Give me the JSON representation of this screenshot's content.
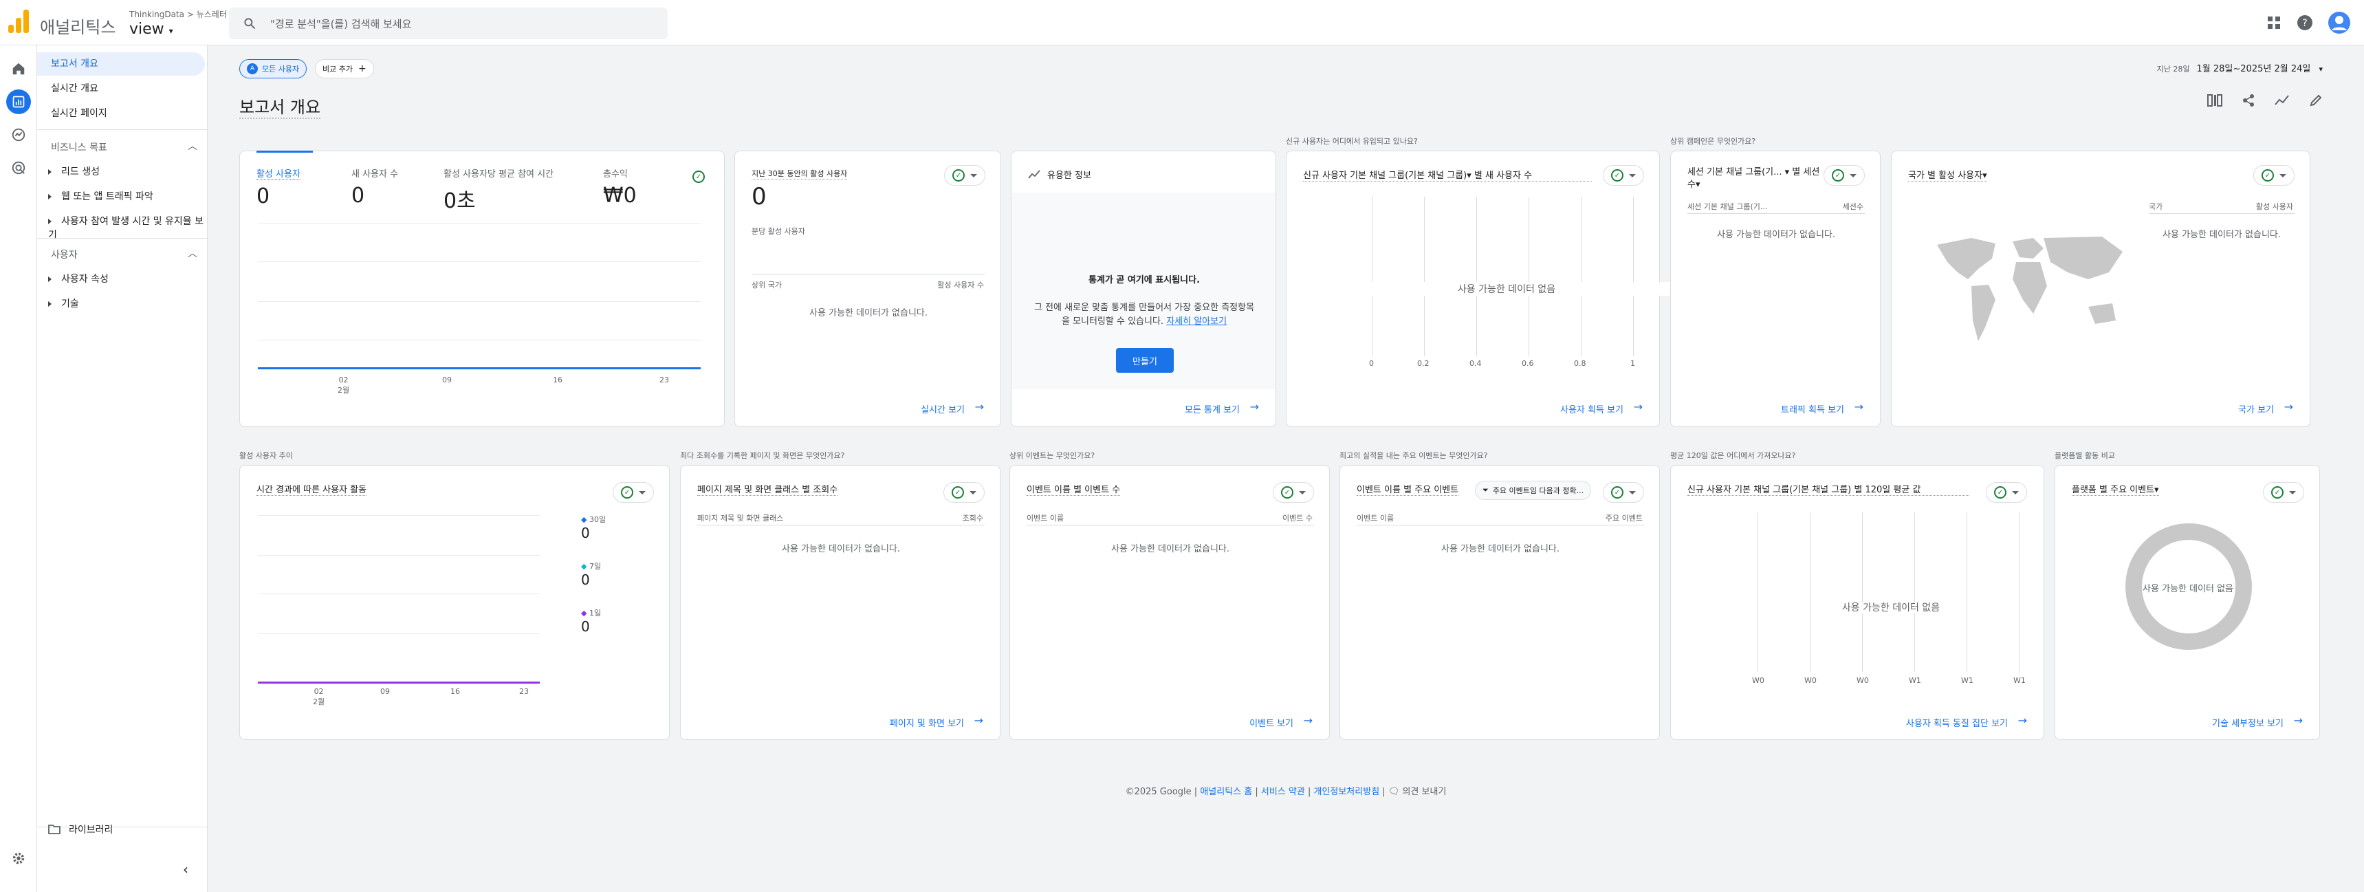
{
  "app": {
    "name": "애널리틱스",
    "account": "ThinkingData > 뉴스레터",
    "property": "view"
  },
  "search": {
    "placeholder": "\"경로 분석\"을(를) 검색해 보세요"
  },
  "nav": {
    "items": [
      "보고서 개요",
      "실시간 개요",
      "실시간 페이지"
    ],
    "sections": [
      {
        "title": "비즈니스 목표",
        "items": [
          "리드 생성",
          "웹 또는 앱 트래픽 파악",
          "사용자 참여 발생 시간 및 유지율 보기"
        ]
      },
      {
        "title": "사용자",
        "items": [
          "사용자 속성",
          "기술"
        ]
      }
    ],
    "library": "라이브러리"
  },
  "toolbar": {
    "chip_all": "모든 사용자",
    "chip_add": "비교 추가",
    "date_prefix": "지난 28일",
    "date_range": "1월 28일~2025년 2월 24일"
  },
  "page_title": "보고서 개요",
  "top_questions": {
    "q1": "신규 사용자는 어디에서 유입되고 있나요?",
    "q2": "상위 캠페인은 무엇인가요?"
  },
  "card1": {
    "metrics": [
      {
        "label": "활성 사용자",
        "value": "0"
      },
      {
        "label": "새 사용자 수",
        "value": "0"
      },
      {
        "label": "활성 사용자당 평균 참여 시간",
        "value": "0초"
      },
      {
        "label": "총수익",
        "value": "₩0"
      }
    ],
    "xticks": [
      "02\n2월",
      "09",
      "16",
      "23"
    ]
  },
  "card2": {
    "title": "지난 30분 동안의 활성 사용자",
    "value": "0",
    "sub": "분당 활성 사용자",
    "col1": "상위 국가",
    "col2": "활성 사용자 수",
    "empty": "사용 가능한 데이터가 없습니다.",
    "link": "실시간 보기"
  },
  "card3": {
    "title": "유용한 정보",
    "heading": "통계가 곧 여기에 표시됩니다.",
    "body": "그 전에 새로운 맞춤 통계를 만들어서 가장 중요한 측정항목을 모니터링할 수 있습니다.",
    "learn": "자세히 알아보기",
    "button": "만들기",
    "link": "모든 통계 보기"
  },
  "card4": {
    "title": "신규 사용자 기본 채널 그룹(기본 채널 그룹)▾ 별 새 사용자 수",
    "empty": "사용 가능한 데이터 없음",
    "xticks": [
      "0",
      "0.2",
      "0.4",
      "0.6",
      "0.8",
      "1"
    ],
    "link": "사용자 획득 보기"
  },
  "card5": {
    "title": "세션 기본 채널 그룹(기... ▾ 별 세션수▾",
    "col1": "세션 기본 채널 그룹(기...",
    "col2": "세션수",
    "empty": "사용 가능한 데이터가 없습니다.",
    "link": "트래픽 획득 보기"
  },
  "card6": {
    "title": "국가 별 활성 사용자▾",
    "col1": "국가",
    "col2": "활성 사용자",
    "empty": "사용 가능한 데이터가 없습니다.",
    "link": "국가 보기"
  },
  "row2_questions": {
    "a": "활성 사용자 추이",
    "b": "최다 조회수를 기록한 페이지 및 화면은 무엇인가요?",
    "c": "상위 이벤트는 무엇인가요?",
    "d": "최고의 실적을 내는 주요 이벤트는 무엇인가요?",
    "e": "평균 120일 값은 어디에서 가져오나요?",
    "f": "플랫폼별 활동 비교"
  },
  "card7": {
    "title": "시간 경과에 따른 사용자 활동",
    "legend": [
      {
        "label": "30일",
        "value": "0",
        "color": "#1a73e8"
      },
      {
        "label": "7일",
        "value": "0",
        "color": "#12b5cb"
      },
      {
        "label": "1일",
        "value": "0",
        "color": "#9334e6"
      }
    ],
    "xticks": [
      "02\n2월",
      "09",
      "16",
      "23"
    ]
  },
  "card8": {
    "title": "페이지 제목 및 화면 클래스 별 조회수",
    "col1": "페이지 제목 및 화면 클래스",
    "col2": "조회수",
    "empty": "사용 가능한 데이터가 없습니다.",
    "link": "페이지 및 화면 보기"
  },
  "card9": {
    "title": "이벤트 이름 별 이벤트 수",
    "col1": "이벤트 이름",
    "col2": "이벤트 수",
    "empty": "사용 가능한 데이터가 없습니다.",
    "link": "이벤트 보기"
  },
  "card10": {
    "title": "이벤트 이름 별 주요 이벤트",
    "filter": "주요 이벤트임 다음과 정확...",
    "col1": "이벤트 이름",
    "col2": "주요 이벤트",
    "empty": "사용 가능한 데이터가 없습니다."
  },
  "card11": {
    "title": "신규 사용자 기본 채널 그룹(기본 채널 그룹) 별 120일 평균 값",
    "empty": "사용 가능한 데이터 없음",
    "xticks": [
      "W0",
      "W0",
      "W0",
      "W1",
      "W1",
      "W1"
    ],
    "link": "사용자 획득 동질 집단 보기"
  },
  "card12": {
    "title": "플랫폼 별 주요 이벤트▾",
    "empty": "사용 가능한 데이터 없음",
    "link": "기술 세부정보 보기"
  },
  "footer": {
    "copyright": "©2025 Google",
    "links": [
      "애널리틱스 홈",
      "서비스 약관",
      "개인정보처리방침"
    ],
    "feedback": "의견 보내기"
  },
  "colors": {
    "accent": "#1a73e8",
    "brand": "#f9ab00"
  }
}
